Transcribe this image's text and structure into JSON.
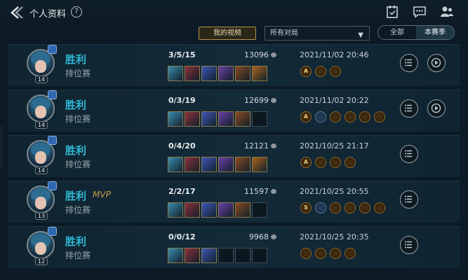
{
  "header": {
    "title": "个人资料",
    "help_symbol": "?"
  },
  "filters": {
    "my_video": "我的视频",
    "select_value": "所有对局",
    "segment": [
      "全部",
      "本赛季"
    ],
    "segment_active": 1
  },
  "colors": {
    "accent_blue": "#2fb9d4",
    "accent_gold": "#c79d46"
  },
  "matches": [
    {
      "result": "胜利",
      "mvp": "",
      "mode": "排位赛",
      "level": "14",
      "kda": "3/5/15",
      "gold": "13096",
      "time": "2021/11/02 20:46",
      "items_filled": 6,
      "medals": [
        "A",
        "",
        ""
      ],
      "has_replay": true
    },
    {
      "result": "胜利",
      "mvp": "",
      "mode": "排位赛",
      "level": "14",
      "kda": "0/3/19",
      "gold": "12699",
      "time": "2021/11/02 20:22",
      "items_filled": 5,
      "medals": [
        "A",
        "",
        "",
        "",
        "",
        ""
      ],
      "has_replay": true
    },
    {
      "result": "胜利",
      "mvp": "",
      "mode": "排位赛",
      "level": "14",
      "kda": "0/4/20",
      "gold": "12121",
      "time": "2021/10/25 21:17",
      "items_filled": 6,
      "medals": [
        "A",
        "",
        "",
        ""
      ],
      "has_replay": false
    },
    {
      "result": "胜利",
      "mvp": "MVP",
      "mode": "排位赛",
      "level": "13",
      "kda": "2/2/17",
      "gold": "11597",
      "time": "2021/10/25 20:55",
      "items_filled": 5,
      "medals": [
        "S",
        "",
        "",
        "",
        "",
        ""
      ],
      "has_replay": false
    },
    {
      "result": "胜利",
      "mvp": "",
      "mode": "排位赛",
      "level": "12",
      "kda": "0/0/12",
      "gold": "9968",
      "time": "2021/10/25 20:35",
      "items_filled": 3,
      "medals": [
        "",
        "",
        "",
        ""
      ],
      "has_replay": false
    }
  ]
}
